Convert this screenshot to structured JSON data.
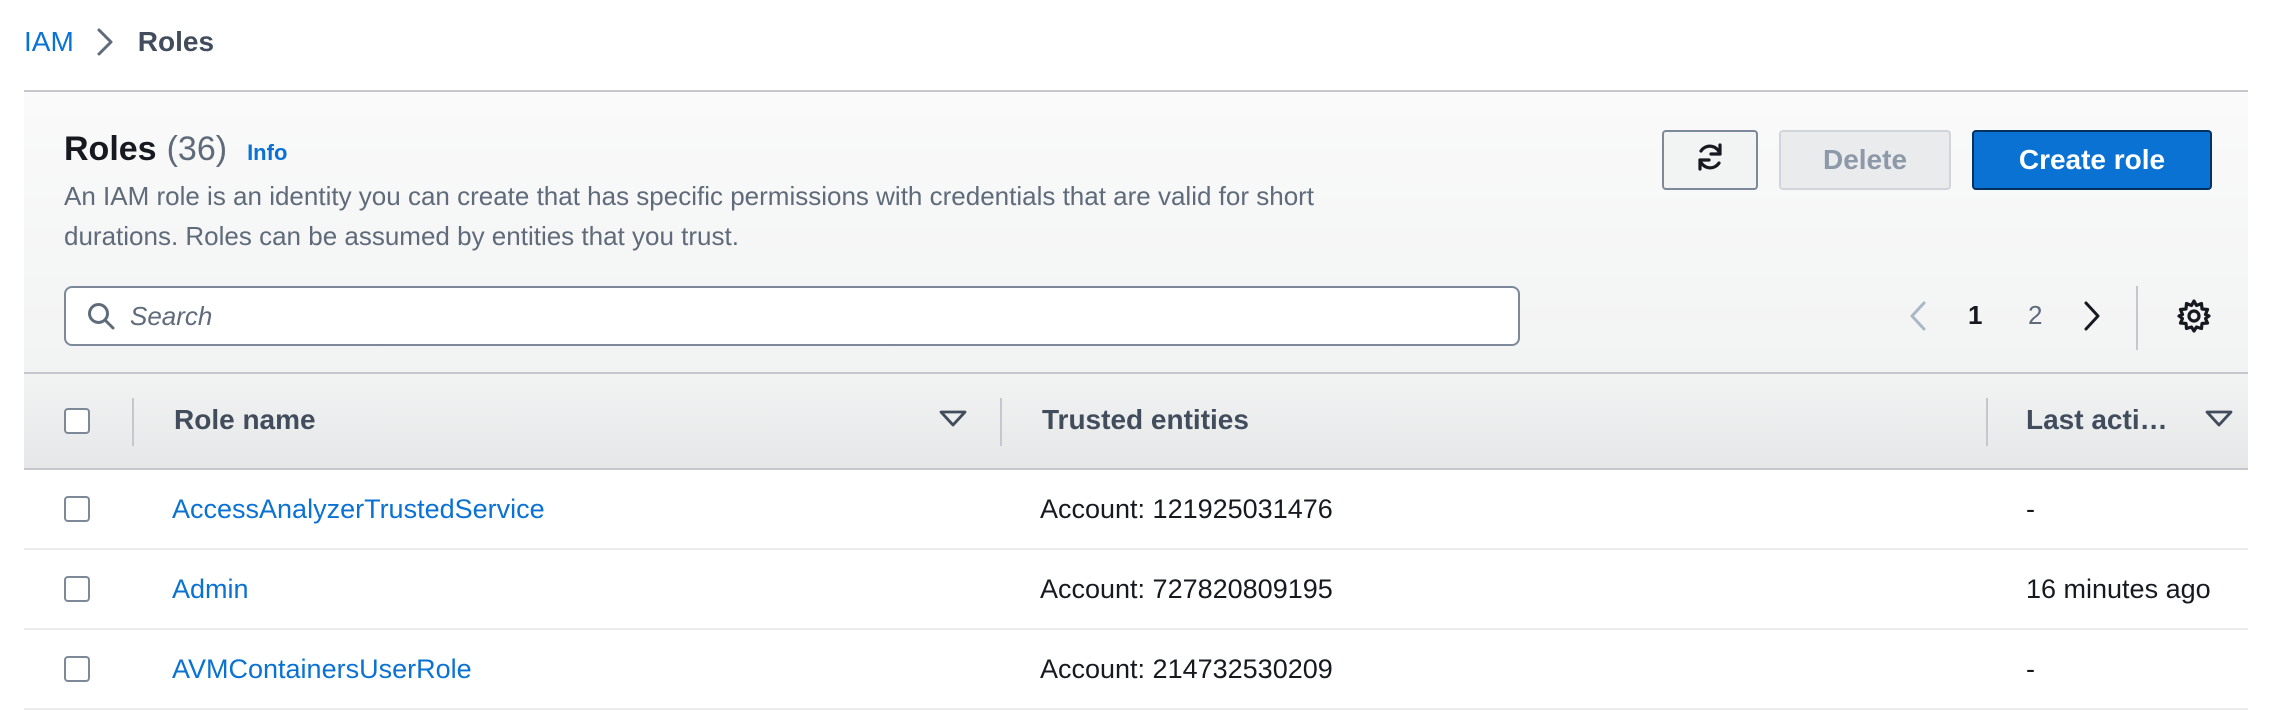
{
  "breadcrumb": {
    "root": "IAM",
    "current": "Roles"
  },
  "header": {
    "title": "Roles",
    "count": "(36)",
    "info": "Info",
    "description_line1": "An IAM role is an identity you can create that has specific permissions with credentials that are valid for short",
    "description_line2": "durations. Roles can be assumed by entities that you trust.",
    "delete_label": "Delete",
    "create_label": "Create role"
  },
  "search": {
    "placeholder": "Search",
    "value": ""
  },
  "pagination": {
    "current": "1",
    "next_page": "2"
  },
  "columns": {
    "role_name": "Role name",
    "trusted_entities": "Trusted entities",
    "last_activity": "Last acti…"
  },
  "rows": [
    {
      "role_name": "AccessAnalyzerTrustedService",
      "trusted": "Account: 121925031476",
      "last_activity": "-"
    },
    {
      "role_name": "Admin",
      "trusted": "Account: 727820809195",
      "last_activity": "16 minutes ago"
    },
    {
      "role_name": "AVMContainersUserRole",
      "trusted": "Account: 214732530209",
      "last_activity": "-"
    }
  ],
  "colors": {
    "accent": "#0972d3",
    "text": "#16191f",
    "muted": "#5f6b7a",
    "border": "#c6c6cd"
  },
  "icons": [
    "chevron-right-icon",
    "refresh-icon",
    "search-icon",
    "chevron-left-icon",
    "settings-gear-icon",
    "sort-caret-icon"
  ]
}
